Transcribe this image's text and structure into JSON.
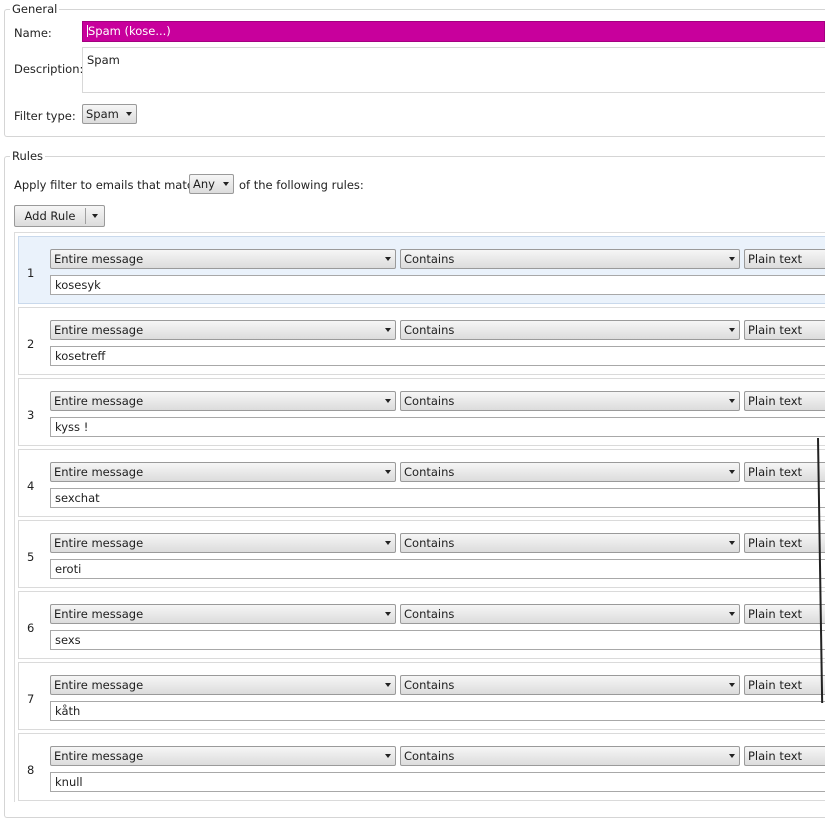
{
  "general": {
    "legend": "General",
    "name_label": "Name:",
    "name_value": "Spam (kose...)",
    "description_label": "Description:",
    "description_value": "Spam",
    "filter_type_label": "Filter type:",
    "filter_type_value": "Spam"
  },
  "rules": {
    "legend": "Rules",
    "apply_prefix": "Apply filter to emails that match",
    "match_value": "Any",
    "apply_suffix": "of the following rules:",
    "add_rule_label": "Add Rule",
    "items": [
      {
        "number": "1",
        "field": "Entire message",
        "operator": "Contains",
        "mode": "Plain text",
        "value": "kosesyk"
      },
      {
        "number": "2",
        "field": "Entire message",
        "operator": "Contains",
        "mode": "Plain text",
        "value": "kosetreff"
      },
      {
        "number": "3",
        "field": "Entire message",
        "operator": "Contains",
        "mode": "Plain text",
        "value": "kyss !"
      },
      {
        "number": "4",
        "field": "Entire message",
        "operator": "Contains",
        "mode": "Plain text",
        "value": "sexchat"
      },
      {
        "number": "5",
        "field": "Entire message",
        "operator": "Contains",
        "mode": "Plain text",
        "value": "eroti"
      },
      {
        "number": "6",
        "field": "Entire message",
        "operator": "Contains",
        "mode": "Plain text",
        "value": "sexs"
      },
      {
        "number": "7",
        "field": "Entire message",
        "operator": "Contains",
        "mode": "Plain text",
        "value": "kåth"
      },
      {
        "number": "8",
        "field": "Entire message",
        "operator": "Contains",
        "mode": "Plain text",
        "value": "knull"
      }
    ]
  },
  "colors": {
    "name_highlight": "#c8009c",
    "selected_row": "#eaf2fb"
  },
  "icons": {
    "dropdown": "chevron-down-icon"
  }
}
